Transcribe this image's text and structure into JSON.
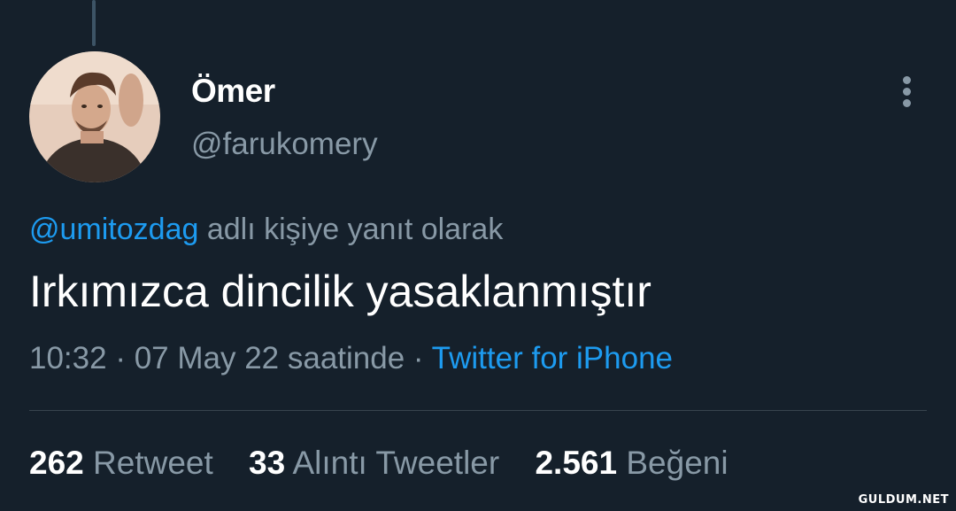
{
  "tweet": {
    "display_name": "Ömer",
    "handle": "@farukomery",
    "reply_mention": "@umitozdag",
    "reply_suffix": " adlı kişiye yanıt olarak",
    "text": "Irkımızca dincilik yasaklanmıştır",
    "time": "10:32",
    "separator": " · ",
    "date": "07 May 22 saatinde",
    "source": "Twitter for iPhone"
  },
  "stats": [
    {
      "count": "262",
      "label": "Retweet"
    },
    {
      "count": "33",
      "label": "Alıntı Tweetler"
    },
    {
      "count": "2.561",
      "label": "Beğeni"
    }
  ],
  "watermark": "GULDUM.NET",
  "icons": {
    "more": "more-vertical-icon",
    "avatar": "avatar"
  },
  "colors": {
    "background": "#15202b",
    "primary_text": "#ffffff",
    "secondary_text": "#8899a6",
    "accent": "#1d9bf0",
    "divider": "#38444d"
  }
}
